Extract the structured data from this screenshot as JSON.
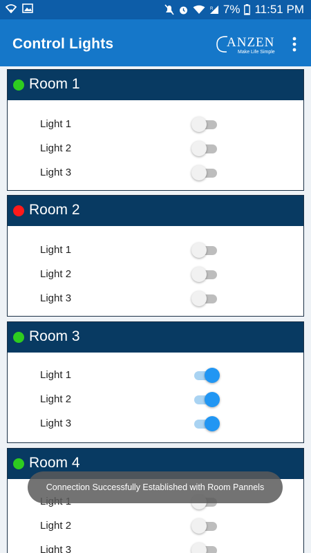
{
  "status_bar": {
    "battery": "7%",
    "time": "11:51 PM"
  },
  "app_bar": {
    "title": "Control Lights",
    "logo_text": "ANZEN",
    "logo_tagline": "Make Life Simple"
  },
  "rooms": [
    {
      "name": "Room 1",
      "status_color": "#2ecc1f",
      "lights": [
        {
          "label": "Light 1",
          "on": false
        },
        {
          "label": "Light 2",
          "on": false
        },
        {
          "label": "Light 3",
          "on": false
        }
      ]
    },
    {
      "name": "Room 2",
      "status_color": "#ff1a1a",
      "lights": [
        {
          "label": "Light 1",
          "on": false
        },
        {
          "label": "Light 2",
          "on": false
        },
        {
          "label": "Light 3",
          "on": false
        }
      ]
    },
    {
      "name": "Room 3",
      "status_color": "#2ecc1f",
      "lights": [
        {
          "label": "Light 1",
          "on": true
        },
        {
          "label": "Light 2",
          "on": true
        },
        {
          "label": "Light 3",
          "on": true
        }
      ]
    },
    {
      "name": "Room 4",
      "status_color": "#2ecc1f",
      "lights": [
        {
          "label": "Light 1",
          "on": false
        },
        {
          "label": "Light 2",
          "on": false
        },
        {
          "label": "Light 3",
          "on": false
        }
      ]
    }
  ],
  "toast": {
    "message": "Connection Successfully Established with Room Pannels"
  },
  "colors": {
    "status_bar": "#0d5da8",
    "app_bar": "#1577c9",
    "room_header": "#083a62",
    "toggle_on": "#2196f3"
  }
}
